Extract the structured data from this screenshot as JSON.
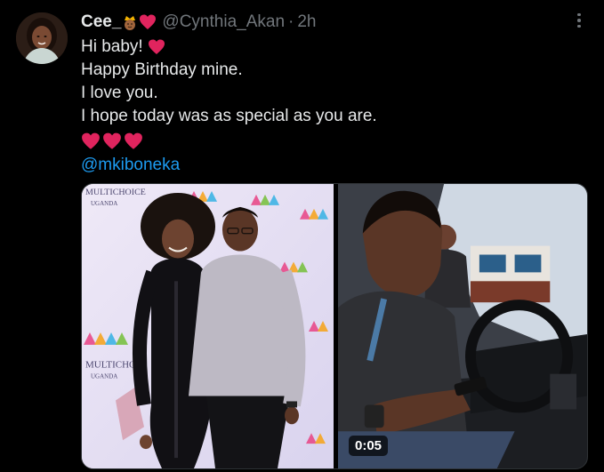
{
  "tweet": {
    "display_name": "Cee_",
    "name_emojis": [
      "crown-woman-emoji",
      "red-heart-emoji"
    ],
    "handle": "@Cynthia_Akan",
    "separator": "·",
    "time": "2h",
    "lines": [
      "Hi baby!",
      "Happy Birthday mine.",
      "I love you.",
      "I hope today was as special as you are."
    ],
    "line1_emoji": "red-heart-emoji",
    "trailing_hearts": 3,
    "mention": "@mkiboneka",
    "media": {
      "photo_alt_logo_text": "MultiChoice",
      "photo_alt_sub_text": "UGANDA",
      "video_duration": "0:05"
    }
  },
  "colors": {
    "background": "#000000",
    "text": "#e7e9ea",
    "secondary": "#71767b",
    "link": "#1d9bf0",
    "heart": "#e0245e"
  }
}
